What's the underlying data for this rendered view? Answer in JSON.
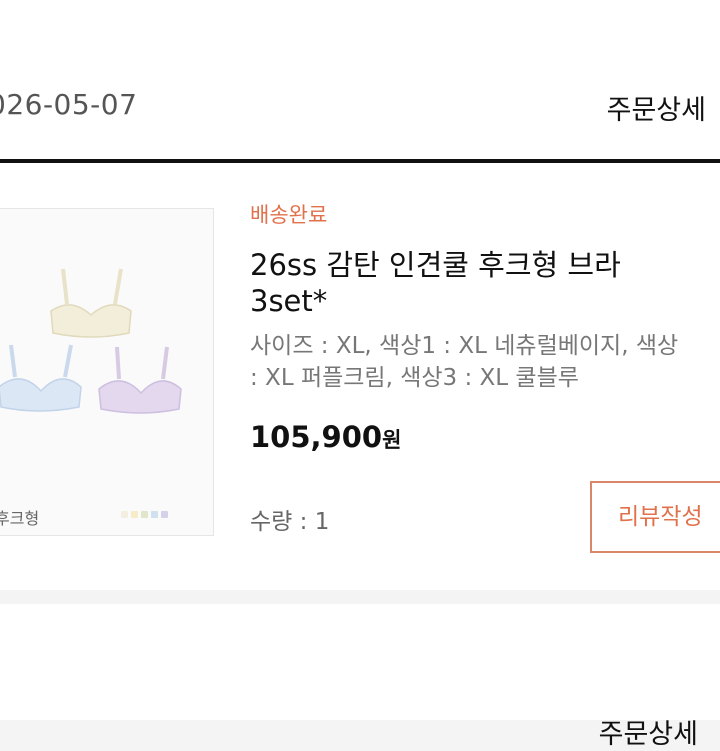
{
  "order": {
    "date": "026-05-07",
    "detail_label": "주문상세"
  },
  "item": {
    "status": "배송완료",
    "title_line1": "26ss 감탄 인견쿨 후크형 브라",
    "title_line2": "3set*",
    "options_line1": "사이즈 : XL, 색상1 : XL 네츄럴베이지, 색상",
    "options_line2": ": XL 퍼플크림, 색상3 : XL 쿨블루",
    "price_value": "105,900",
    "price_unit": "원",
    "quantity": "수량 : 1",
    "review_button": "리뷰작성"
  },
  "thumbnail": {
    "caption": "후크형",
    "swatch_colors": [
      "#f3efe0",
      "#f6edc8",
      "#dfe6c9",
      "#cfe0ee",
      "#d6d1ea"
    ]
  },
  "next_order": {
    "detail_label": "주문상세"
  }
}
